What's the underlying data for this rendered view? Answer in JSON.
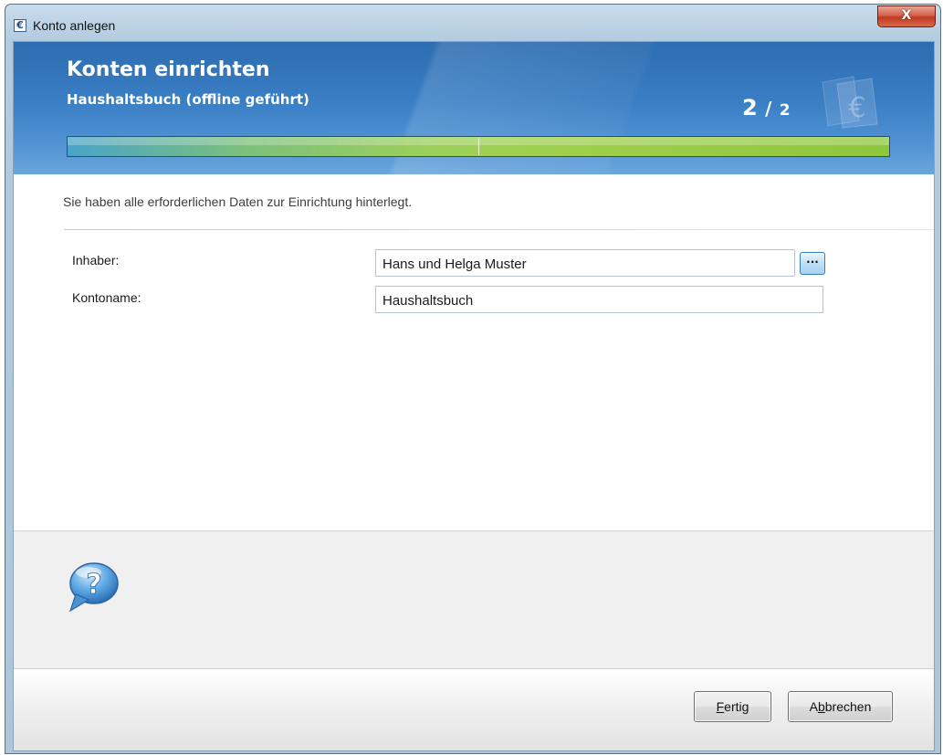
{
  "window": {
    "title": "Konto anlegen",
    "app_icon_glyph": "€",
    "close_glyph": "X"
  },
  "header": {
    "title": "Konten einrichten",
    "subtitle": "Haushaltsbuch (offline geführt)",
    "step_current": "2",
    "step_separator": "/",
    "step_total": "2",
    "progress_fraction": 1.0,
    "logo_icon": "euro-card-icon"
  },
  "main": {
    "intro": "Sie haben alle erforderlichen Daten zur Einrichtung hinterlegt.",
    "fields": {
      "owner_label": "Inhaber:",
      "owner_value": "Hans und Helga Muster",
      "owner_browse_label": "...",
      "account_name_label": "Kontoname:",
      "account_name_value": "Haushaltsbuch"
    }
  },
  "help": {
    "icon": "help-bubble-icon"
  },
  "buttons": {
    "finish": {
      "mnemonic": "F",
      "rest": "ertig"
    },
    "cancel": {
      "before": "A",
      "mnemonic": "b",
      "rest": "brechen"
    }
  },
  "colors": {
    "header_blue": "#3a7ec4",
    "progress_green": "#9dd05a",
    "close_red": "#c1391f"
  }
}
